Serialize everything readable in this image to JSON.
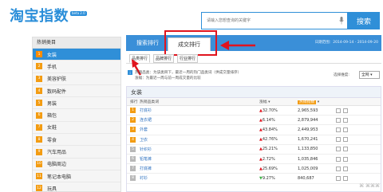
{
  "header": {
    "logo": "淘宝指数",
    "beta": "beta 2.0",
    "search_placeholder": "请输入您想查询的关键字",
    "search_button": "搜索"
  },
  "sidebar": {
    "title": "热销类目",
    "items": [
      {
        "num": "1",
        "label": "女装"
      },
      {
        "num": "2",
        "label": "手机"
      },
      {
        "num": "3",
        "label": "美容护肤"
      },
      {
        "num": "4",
        "label": "数码配件"
      },
      {
        "num": "5",
        "label": "男装"
      },
      {
        "num": "6",
        "label": "箱包"
      },
      {
        "num": "7",
        "label": "女鞋"
      },
      {
        "num": "8",
        "label": "零食"
      },
      {
        "num": "9",
        "label": "汽车用品"
      },
      {
        "num": "10",
        "label": "电脑周边"
      },
      {
        "num": "11",
        "label": "笔记本电脑"
      },
      {
        "num": "12",
        "label": "玩具"
      }
    ]
  },
  "main": {
    "tabs": [
      {
        "label": "搜索排行"
      },
      {
        "label": "成交排行"
      }
    ],
    "date_range": "日期范围：2014-09-14 - 2014-09-20",
    "subtabs": [
      {
        "label": "品类排行"
      },
      {
        "label": "品牌排行"
      },
      {
        "label": "行业排行"
      }
    ],
    "note1": "热销品类：为该类目下，最近一周的热门品类词（供成交量排序）",
    "note2": "涨幅：为最近一周与前一周成交量的比较",
    "period_label": "选择维度:",
    "period_value": "全网",
    "table_title": "女装",
    "columns": {
      "rank": "排行",
      "keyword": "热销品类词",
      "growth": "涨幅",
      "index": "热销指数"
    },
    "rows": [
      {
        "rank": "1",
        "keyword": "打底衫",
        "trend": "up",
        "growth": "32.70%",
        "index": "2,965,593"
      },
      {
        "rank": "2",
        "keyword": "连衣裙",
        "trend": "up",
        "growth": "6.14%",
        "index": "2,879,944"
      },
      {
        "rank": "3",
        "keyword": "外套",
        "trend": "up",
        "growth": "43.84%",
        "index": "2,449,953"
      },
      {
        "rank": "4",
        "keyword": "卫衣",
        "trend": "up",
        "growth": "42.76%",
        "index": "1,670,241"
      },
      {
        "rank": "5",
        "keyword": "针织衫",
        "trend": "up",
        "growth": "25.21%",
        "index": "1,133,850"
      },
      {
        "rank": "6",
        "keyword": "铅笔裤",
        "trend": "up",
        "growth": "2.72%",
        "index": "1,035,846"
      },
      {
        "rank": "7",
        "keyword": "打底裤",
        "trend": "up",
        "growth": "25.69%",
        "index": "1,025,009"
      },
      {
        "rank": "8",
        "keyword": "衬衫",
        "trend": "down",
        "growth": "9.27%",
        "index": "840,687"
      }
    ]
  },
  "colors": {
    "accent": "#2f8fd8",
    "highlight": "#e0141e",
    "badge": "#f39c12"
  }
}
